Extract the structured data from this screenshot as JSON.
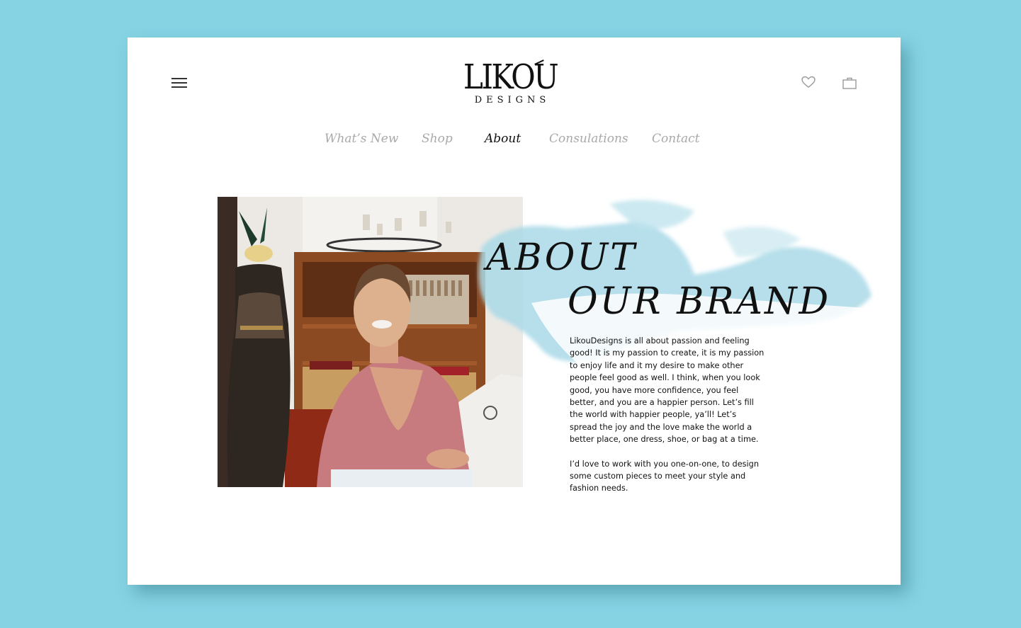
{
  "header": {
    "logo_main": "LIKOU",
    "logo_sub": "DESIGNS",
    "menu_icon": "hamburger-menu-icon",
    "wishlist_icon": "heart-icon",
    "cart_icon": "shopping-bag-icon"
  },
  "nav": {
    "items": [
      {
        "label": "What’s New"
      },
      {
        "label": "Shop"
      },
      {
        "label": "About"
      },
      {
        "label": "Consulations"
      },
      {
        "label": "Contact"
      }
    ],
    "active": "About"
  },
  "about": {
    "title_line1": "ABOUT",
    "title_line2": "OUR BRAND",
    "paragraph1": "LikouDesigns is all about passion and feeling good! It is my passion to create, it is my passion to enjoy life and it my desire to make other people feel good as well. I think, when you look good, you have more confidence, you feel better, and you are a happier person. Let’s fill the world with happier people, ya’ll! Let’s spread the joy and the love make the world a better place, one dress, shoe, or bag at a time.",
    "paragraph2": "I’d love to work with you one-on-one, to design some custom pieces to meet your style and fashion needs."
  },
  "colors": {
    "background": "#86d3e4",
    "card": "#ffffff",
    "brush": "#a9d9e8",
    "nav_inactive": "#a9a9a9",
    "nav_active": "#111111"
  }
}
